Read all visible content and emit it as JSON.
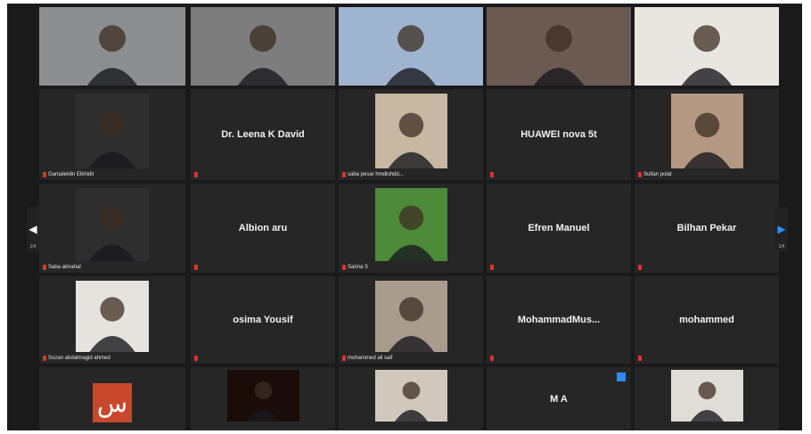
{
  "participants": [
    {
      "name": "",
      "type": "video",
      "active": true,
      "bg": "#8c8f91"
    },
    {
      "name": "",
      "type": "video",
      "bg": "#7d7d7d"
    },
    {
      "name": "",
      "type": "video",
      "bg": "#9fb4d0"
    },
    {
      "name": "",
      "type": "video",
      "bg": "#6b5a52"
    },
    {
      "name": "",
      "type": "video",
      "bg": "#e9e6e2"
    },
    {
      "name": "Gamaleldin Elkhidir",
      "type": "video",
      "bg": "#2e2e2e"
    },
    {
      "name": "Dr. Leena K David",
      "type": "name"
    },
    {
      "name": "saba pesar hmdlohdd...",
      "type": "video",
      "bg": "#c8b8a2"
    },
    {
      "name": "HUAWEI nova 5t",
      "type": "name"
    },
    {
      "name": "Sultan polat",
      "type": "video",
      "bg": "#b49882"
    },
    {
      "name": "Saba almahal",
      "type": "video",
      "bg": "#2e2e2e"
    },
    {
      "name": "Albion aru",
      "type": "name"
    },
    {
      "name": "Sarina S",
      "type": "video",
      "bg": "#4d8a3a"
    },
    {
      "name": "Efren Manuel",
      "type": "name"
    },
    {
      "name": "Bilhan Pekar",
      "type": "name"
    },
    {
      "name": "Sozan abdalmagid ahmed",
      "type": "video",
      "bg": "#e6e3de"
    },
    {
      "name": "osima Yousif",
      "type": "name"
    },
    {
      "name": "mohammed ali saif",
      "type": "video",
      "bg": "#a99c8d"
    },
    {
      "name": "MohammadMus...",
      "type": "name"
    },
    {
      "name": "mohammed",
      "type": "name"
    },
    {
      "name": "",
      "type": "logo",
      "logo_text": "س",
      "logo_color": "#c8472d"
    },
    {
      "name": "",
      "type": "video",
      "bg": "#1a0d07"
    },
    {
      "name": "",
      "type": "video",
      "bg": "#d1c8bd"
    },
    {
      "name": "M A",
      "type": "name"
    },
    {
      "name": "",
      "type": "video",
      "bg": "#e0dcd6"
    }
  ],
  "nav": {
    "left_arrow": "◀",
    "right_arrow": "▶",
    "left_page": "1/4",
    "right_page": "1/4"
  },
  "colors": {
    "accent": "#2d8cff",
    "active_border": "#8bd14b",
    "mic_muted": "#e0342a"
  }
}
